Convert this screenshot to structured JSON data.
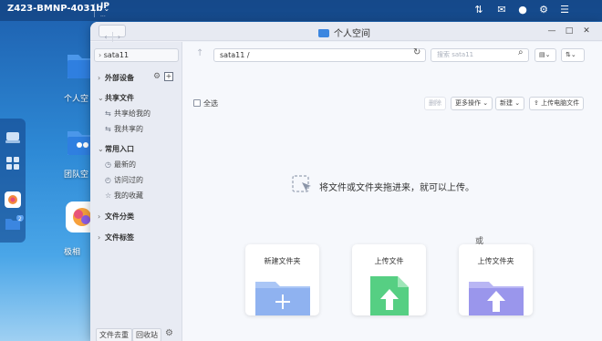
{
  "topbar": {
    "device_name": "Z423-BMNP-4031b",
    "ip_main": "IP",
    "ip_sub": "...",
    "icons": [
      "updown-arrows-icon",
      "mail-icon",
      "user-icon",
      "gear-icon",
      "list-icon"
    ]
  },
  "desktop": {
    "icons": [
      {
        "name": "personal-space",
        "label": "个人空"
      },
      {
        "name": "team-space",
        "label": "团队空"
      },
      {
        "name": "gallery",
        "label": "极相"
      }
    ],
    "dock_badge": "2"
  },
  "window": {
    "title": "个人空间",
    "nav": {
      "back": "‹",
      "forward": "›"
    },
    "controls": {
      "minimize": "—",
      "maximize": "□",
      "close": "✕"
    }
  },
  "sidebar": {
    "current": "sata11",
    "sections": [
      {
        "label": "外部设备",
        "items": []
      },
      {
        "label": "共享文件",
        "items": [
          "共享给我的",
          "我共享的"
        ]
      },
      {
        "label": "常用入口",
        "items": [
          "最新的",
          "访问过的",
          "我的收藏"
        ]
      },
      {
        "label": "文件分类",
        "items": []
      },
      {
        "label": "文件标签",
        "items": []
      }
    ],
    "bottom": {
      "manage": "文件去重",
      "recycle": "回收站"
    }
  },
  "main": {
    "path": "sata11 /",
    "search_placeholder": "搜索 sata11",
    "select_all": "全选",
    "buttons": {
      "delete": "删除",
      "more": "更多操作",
      "new": "新建",
      "upload_pc": "上传电脑文件"
    },
    "drop_hint": "将文件或文件夹拖进来，就可以上传。",
    "or": "或",
    "cards": [
      {
        "label": "新建文件夹",
        "color": "#7fa8f0"
      },
      {
        "label": "上传文件",
        "color": "#4dc97a"
      },
      {
        "label": "上传文件夹",
        "color": "#8a86e8"
      }
    ]
  }
}
